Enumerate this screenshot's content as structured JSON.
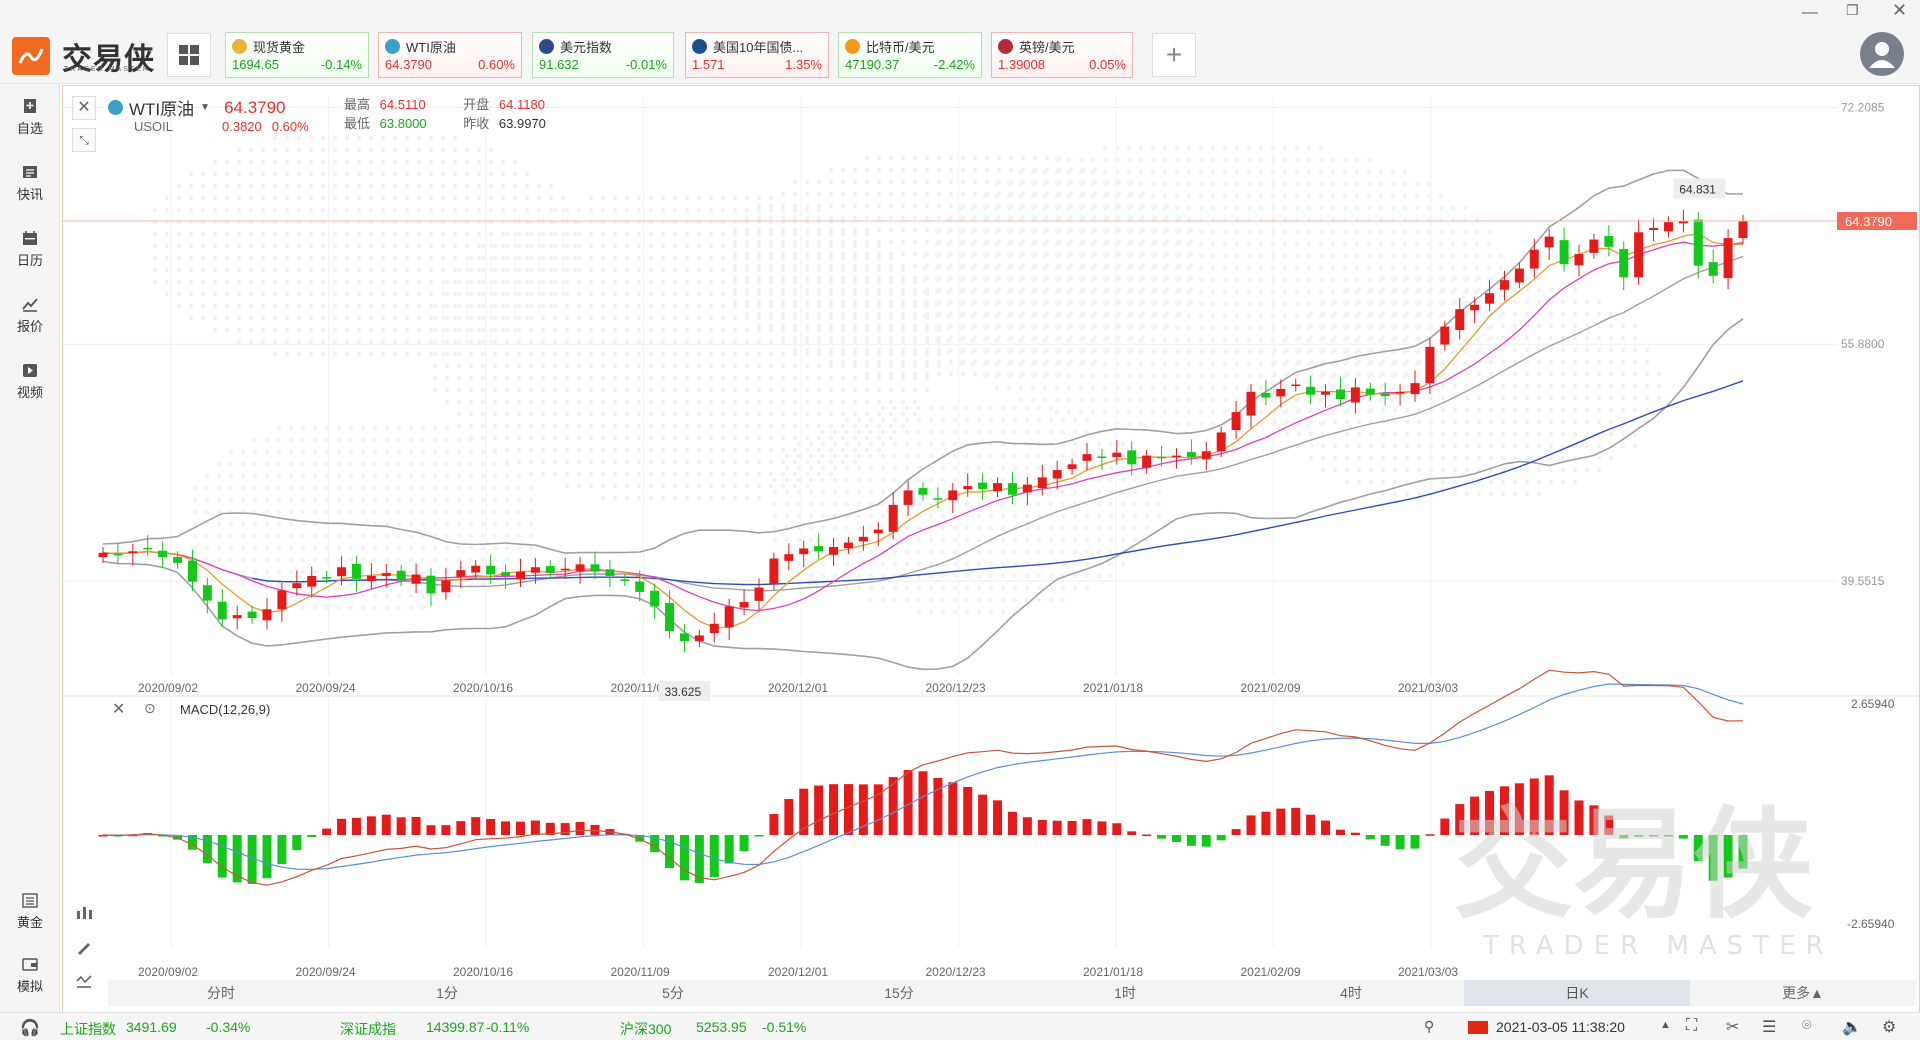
{
  "app": {
    "name": "交易侠",
    "subtitle": "TRADER MASTER"
  },
  "tickers": [
    {
      "name": "现货黄金",
      "price": "1694.65",
      "change": "-0.14%",
      "dir": "dn",
      "icon": "gold-icon",
      "color": "#e8b53a"
    },
    {
      "name": "WTI原油",
      "price": "64.3790",
      "change": "0.60%",
      "dir": "up",
      "icon": "oil-icon",
      "color": "#3aa0c8"
    },
    {
      "name": "美元指数",
      "price": "91.632",
      "change": "-0.01%",
      "dir": "dn",
      "icon": "us-flag-icon",
      "color": "#2e4a8c"
    },
    {
      "name": "美国10年国债...",
      "price": "1.571",
      "change": "1.35%",
      "dir": "up",
      "icon": "bond-icon",
      "color": "#1b4f8a"
    },
    {
      "name": "比特币/美元",
      "price": "47190.37",
      "change": "-2.42%",
      "dir": "dn",
      "icon": "bitcoin-icon",
      "color": "#f29a1a"
    },
    {
      "name": "英镑/美元",
      "price": "1.39008",
      "change": "0.05%",
      "dir": "up",
      "icon": "uk-us-flag-icon",
      "color": "#b52a3a"
    }
  ],
  "sidebar": {
    "top": [
      {
        "label": "自选",
        "icon": "watchlist-icon"
      },
      {
        "label": "快讯",
        "icon": "news-icon"
      },
      {
        "label": "日历",
        "icon": "calendar-icon"
      },
      {
        "label": "报价",
        "icon": "quote-icon"
      },
      {
        "label": "视频",
        "icon": "video-icon"
      }
    ],
    "bottom": [
      {
        "label": "黄金",
        "icon": "gold-bars-icon"
      },
      {
        "label": "模拟",
        "icon": "wallet-icon"
      }
    ]
  },
  "instrument": {
    "name": "WTI原油",
    "code": "USOIL",
    "price": "64.3790",
    "change": "0.3820",
    "change_pct": "0.60%",
    "high_label": "最高",
    "high": "64.5110",
    "open_label": "开盘",
    "open": "64.1180",
    "low_label": "最低",
    "low": "63.8000",
    "prev_label": "昨收",
    "prev": "63.9970"
  },
  "main_chart": {
    "y_ticks": [
      "72.2085",
      "55.8800",
      "39.5515"
    ],
    "current_price_label": "64.3790",
    "max_label": "64.831",
    "min_label": "33.625",
    "x_ticks": [
      "2020/09/02",
      "2020/09/24",
      "2020/10/16",
      "2020/11/09",
      "2020/12/01",
      "2020/12/23",
      "2021/01/18",
      "2021/02/09",
      "2021/03/03"
    ]
  },
  "macd": {
    "title": "MACD(12,26,9)",
    "y_top": "2.65940",
    "y_bottom": "-2.65940"
  },
  "watermark": {
    "text": "交易侠",
    "sub": "TRADER MASTER"
  },
  "periods": [
    "分时",
    "1分",
    "5分",
    "15分",
    "1时",
    "4时",
    "日K",
    "更多▲"
  ],
  "status": {
    "indices": [
      {
        "name": "上证指数",
        "value": "3491.69",
        "change": "-0.34%"
      },
      {
        "name": "深证成指",
        "value": "14399.87",
        "change": "-0.11%"
      },
      {
        "name": "沪深300",
        "value": "5253.95",
        "change": "-0.51%"
      }
    ],
    "datetime": "2021-03-05 11:38:20"
  },
  "chart_data": {
    "type": "candlestick",
    "title": "WTI原油 USOIL 日K",
    "ylim": [
      33.0,
      73.0
    ],
    "x_ticks": [
      "2020/09/02",
      "2020/09/24",
      "2020/10/16",
      "2020/11/09",
      "2020/12/01",
      "2020/12/23",
      "2021/01/18",
      "2021/02/09",
      "2021/03/03"
    ],
    "close_approx": [
      41.5,
      41.4,
      41.6,
      41.8,
      41.2,
      40.8,
      39.5,
      38.2,
      36.9,
      37.2,
      37.0,
      37.6,
      38.9,
      39.4,
      39.9,
      39.8,
      40.5,
      39.7,
      39.9,
      40.1,
      39.6,
      40.0,
      38.7,
      39.6,
      40.3,
      40.6,
      40.0,
      39.9,
      40.2,
      40.5,
      40.1,
      40.4,
      40.7,
      40.2,
      39.9,
      39.6,
      38.8,
      37.8,
      36.1,
      35.4,
      35.8,
      36.6,
      37.8,
      38.1,
      39.1,
      41.1,
      41.4,
      41.8,
      41.6,
      41.9,
      42.2,
      42.6,
      43.1,
      44.8,
      45.8,
      45.5,
      45.2,
      45.8,
      46.1,
      45.9,
      46.3,
      45.5,
      46.2,
      46.7,
      47.2,
      47.6,
      48.3,
      48.1,
      48.4,
      47.6,
      48.2,
      48.1,
      48.2,
      48.1,
      48.5,
      49.8,
      51.2,
      52.6,
      52.2,
      52.8,
      53.1,
      52.4,
      52.6,
      52.1,
      52.9,
      52.4,
      52.3,
      52.6,
      53.2,
      55.7,
      57.1,
      58.3,
      58.6,
      59.4,
      60.3,
      61.1,
      62.4,
      63.3,
      61.4,
      62.1,
      63.1,
      62.6,
      60.5,
      63.6,
      63.9,
      64.3,
      64.4,
      61.3,
      60.6,
      63.2,
      64.4
    ],
    "series": [
      {
        "name": "MA5",
        "color": "#e89a2a"
      },
      {
        "name": "MA10",
        "color": "#e040c0"
      },
      {
        "name": "BOLL",
        "color": "#999999"
      },
      {
        "name": "MA60",
        "color": "#2c4fbd"
      }
    ],
    "macd_ylim": [
      -2.6594,
      2.6594
    ]
  }
}
